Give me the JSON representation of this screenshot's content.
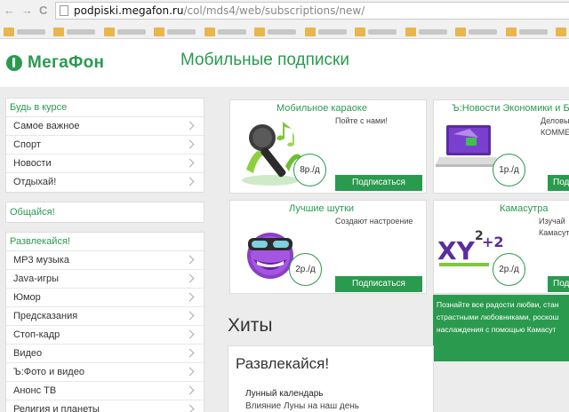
{
  "browser": {
    "url_host": "podpiski.megafon.ru",
    "url_path": "/col/mds4/web/subscriptions/new/",
    "back_glyph": "←",
    "forward_glyph": "→",
    "reload_glyph": "C"
  },
  "header": {
    "logo_text": "МегаФон",
    "page_title": "Мобильные подписки"
  },
  "sidebar": {
    "section1": {
      "title": "Будь в курсе",
      "items": [
        "Самое важное",
        "Спорт",
        "Новости",
        "Отдыхай!"
      ]
    },
    "section2": {
      "title": "Общайся!"
    },
    "section3": {
      "title": "Развлекайся!",
      "items": [
        "МР3 музыка",
        "Java-игры",
        "Юмор",
        "Предсказания",
        "Стоп-кадр",
        "Видео",
        "Ъ:Фото и видео",
        "Анонс ТВ",
        "Религия и планеты"
      ]
    }
  },
  "cards": [
    {
      "title": "Мобильное караоке",
      "desc": "Пойте с нами!",
      "price": "8р./д",
      "button": "Подписаться"
    },
    {
      "title": "Ъ:Новости Экономики и Бизнеса",
      "desc": "Деловы",
      "desc2": "КОММЕ",
      "price": "1р./д",
      "button": "Подп"
    },
    {
      "title": "Лучшие шутки",
      "desc": "Создают настроение",
      "price": "2р./д",
      "button": "Подписаться"
    },
    {
      "title": "Камасутра",
      "desc": "Изучай",
      "desc2": "Камасут",
      "price": "2р./д",
      "button": "Подп"
    }
  ],
  "promo": {
    "line1": "Познайте все радости любви, стан",
    "line2": "страстными любовниками, роскош",
    "line3": "наслаждения с помощью Камасут"
  },
  "main": {
    "hits_title": "Хиты",
    "fun_title": "Развлекайся!",
    "fun_item_title": "Лунный календарь",
    "fun_item_desc": "Влияние Луны на наш день"
  },
  "colors": {
    "brand": "#2a9a4e"
  },
  "icons": {
    "karaoke": "microphone-icon",
    "news": "laptop-icon",
    "jokes": "smiley-icon",
    "kamasutra": "xy-formula-icon"
  }
}
